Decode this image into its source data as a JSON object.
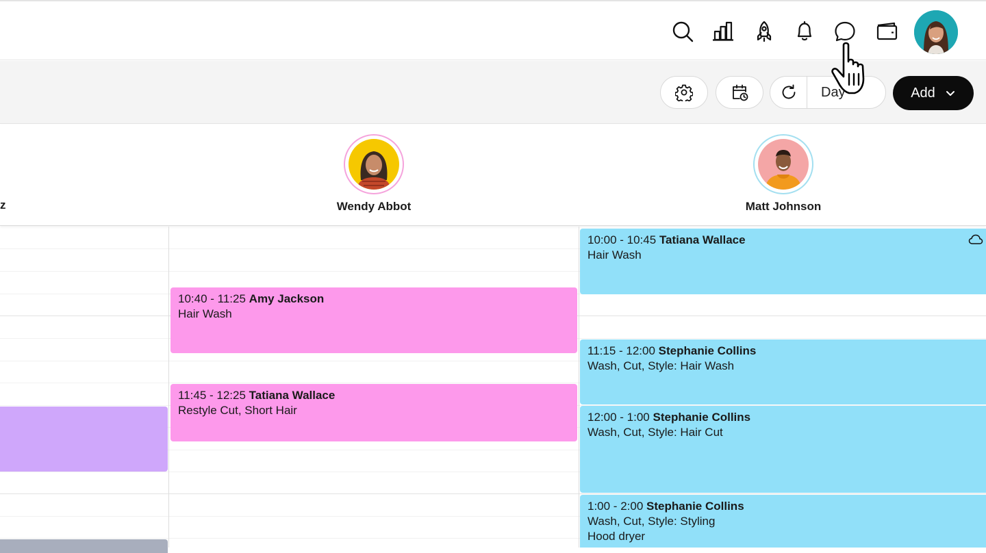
{
  "header": {
    "icons": [
      "search-icon",
      "bar-chart-icon",
      "rocket-icon",
      "bell-icon",
      "chat-icon",
      "wallet-icon"
    ],
    "user_avatar": "profile-avatar"
  },
  "toolbar": {
    "settings_icon": "gear-icon",
    "schedule_icon": "calendar-clock-icon",
    "refresh_icon": "refresh-icon",
    "view_label": "Day",
    "add_label": "Add"
  },
  "staff": [
    {
      "name": "z",
      "partial": true
    },
    {
      "name": "Wendy Abbot",
      "ring_color": "#f5a3dc"
    },
    {
      "name": "Matt Johnson",
      "ring_color": "#a3dff0"
    }
  ],
  "appointments": {
    "wendy": [
      {
        "time": "10:40 - 11:25",
        "client": "Amy Jackson",
        "service": "Hair Wash",
        "color": "#fd99eb"
      },
      {
        "time": "11:45 - 12:25",
        "client": "Tatiana Wallace",
        "service": "Restyle Cut, Short Hair",
        "color": "#fd99eb"
      }
    ],
    "matt": [
      {
        "time": "10:00 - 10:45",
        "client": "Tatiana Wallace",
        "service": "Hair Wash",
        "color": "#91e0f9",
        "icon": "cloud-icon"
      },
      {
        "time": "11:15 - 12:00",
        "client": "Stephanie Collins",
        "service": "Wash, Cut, Style: Hair Wash",
        "color": "#91e0f9"
      },
      {
        "time": "12:00 - 1:00",
        "client": "Stephanie Collins",
        "service": "Wash, Cut, Style: Hair Cut",
        "color": "#91e0f9"
      },
      {
        "time": "1:00 - 2:00",
        "client": "Stephanie Collins",
        "service": "Wash, Cut, Style: Styling",
        "service2": "Hood dryer",
        "color": "#91e0f9"
      }
    ]
  }
}
